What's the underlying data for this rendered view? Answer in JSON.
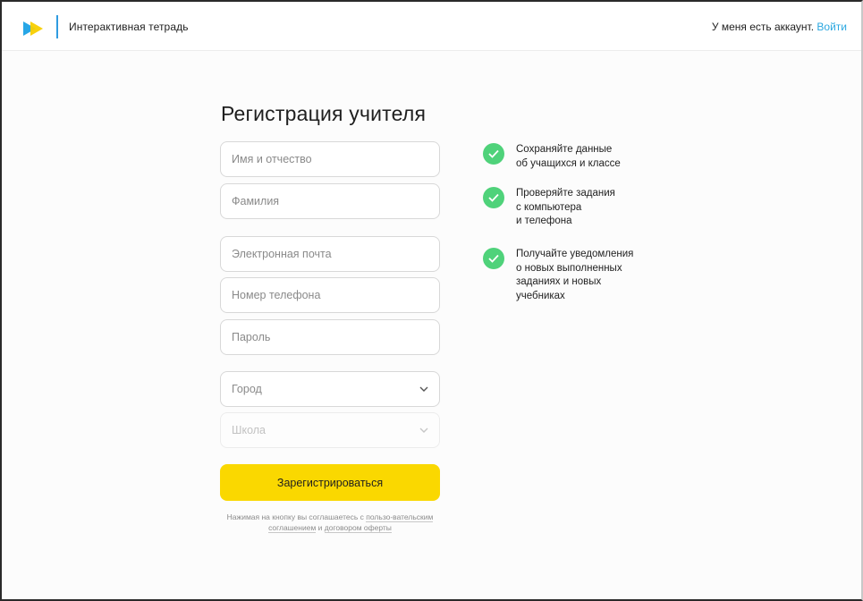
{
  "header": {
    "app_title": "Интерактивная тетрадь",
    "account_text": "У меня есть аккаунт.",
    "login_link": "Войти"
  },
  "form": {
    "title": "Регистрация учителя",
    "first_name_placeholder": "Имя и отчество",
    "last_name_placeholder": "Фамилия",
    "email_placeholder": "Электронная почта",
    "phone_placeholder": "Номер телефона",
    "password_placeholder": "Пароль",
    "city_placeholder": "Город",
    "school_placeholder": "Школа",
    "submit_label": "Зарегистрироваться",
    "terms_prefix": "Нажимая на кнопку вы соглашаетесь с ",
    "terms_link_user_agreement": "пользо-вательским соглашением",
    "terms_and": " и ",
    "terms_link_offer": "договором оферты"
  },
  "benefits": [
    {
      "text": "Сохраняйте данные\nоб учащихся и классе"
    },
    {
      "text": "Проверяйте задания\nс компьютера\nи телефона"
    },
    {
      "text": "Получайте уведомления\nо новых выполненных\nзаданиях и новых\nучебниках"
    }
  ],
  "colors": {
    "accent_yellow": "#fad800",
    "link_blue": "#2aa7e0",
    "check_green": "#4fd27a",
    "logo_blue": "#2f9be0"
  },
  "icons": {
    "logo": "play-logo-icon",
    "select_arrow": "chevron-down-icon",
    "benefit": "check-circle-icon"
  }
}
